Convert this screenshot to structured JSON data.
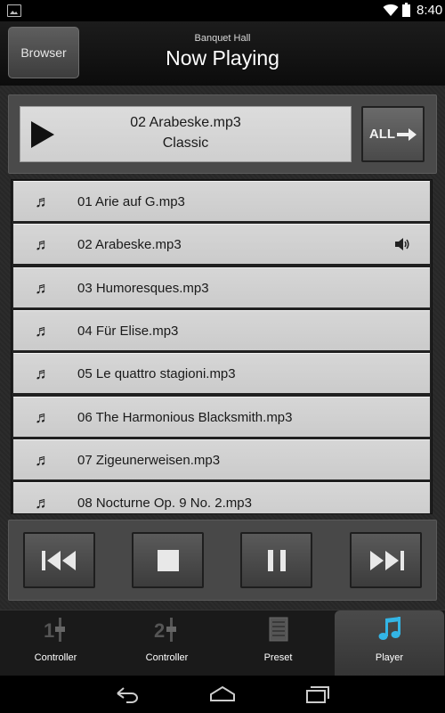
{
  "status_bar": {
    "time": "8:40"
  },
  "header": {
    "browser_label": "Browser",
    "subtitle": "Banquet Hall",
    "title": "Now Playing"
  },
  "now_playing": {
    "track": "02 Arabeske.mp3",
    "genre": "Classic",
    "all_label": "ALL"
  },
  "playlist": {
    "playing_index": 1,
    "items": [
      {
        "name": "01 Arie auf G.mp3"
      },
      {
        "name": "02 Arabeske.mp3"
      },
      {
        "name": "03 Humoresques.mp3"
      },
      {
        "name": "04 Für Elise.mp3"
      },
      {
        "name": "05 Le quattro stagioni.mp3"
      },
      {
        "name": "06 The Harmonious Blacksmith.mp3"
      },
      {
        "name": "07 Zigeunerweisen.mp3"
      },
      {
        "name": "08 Nocturne Op. 9 No. 2.mp3"
      }
    ]
  },
  "tabs": [
    {
      "label": "Controller",
      "icon": "fader-1-icon"
    },
    {
      "label": "Controller",
      "icon": "fader-2-icon"
    },
    {
      "label": "Preset",
      "icon": "preset-icon"
    },
    {
      "label": "Player",
      "icon": "music-note-icon",
      "active": true
    }
  ],
  "colors": {
    "accent": "#33b5e5"
  }
}
